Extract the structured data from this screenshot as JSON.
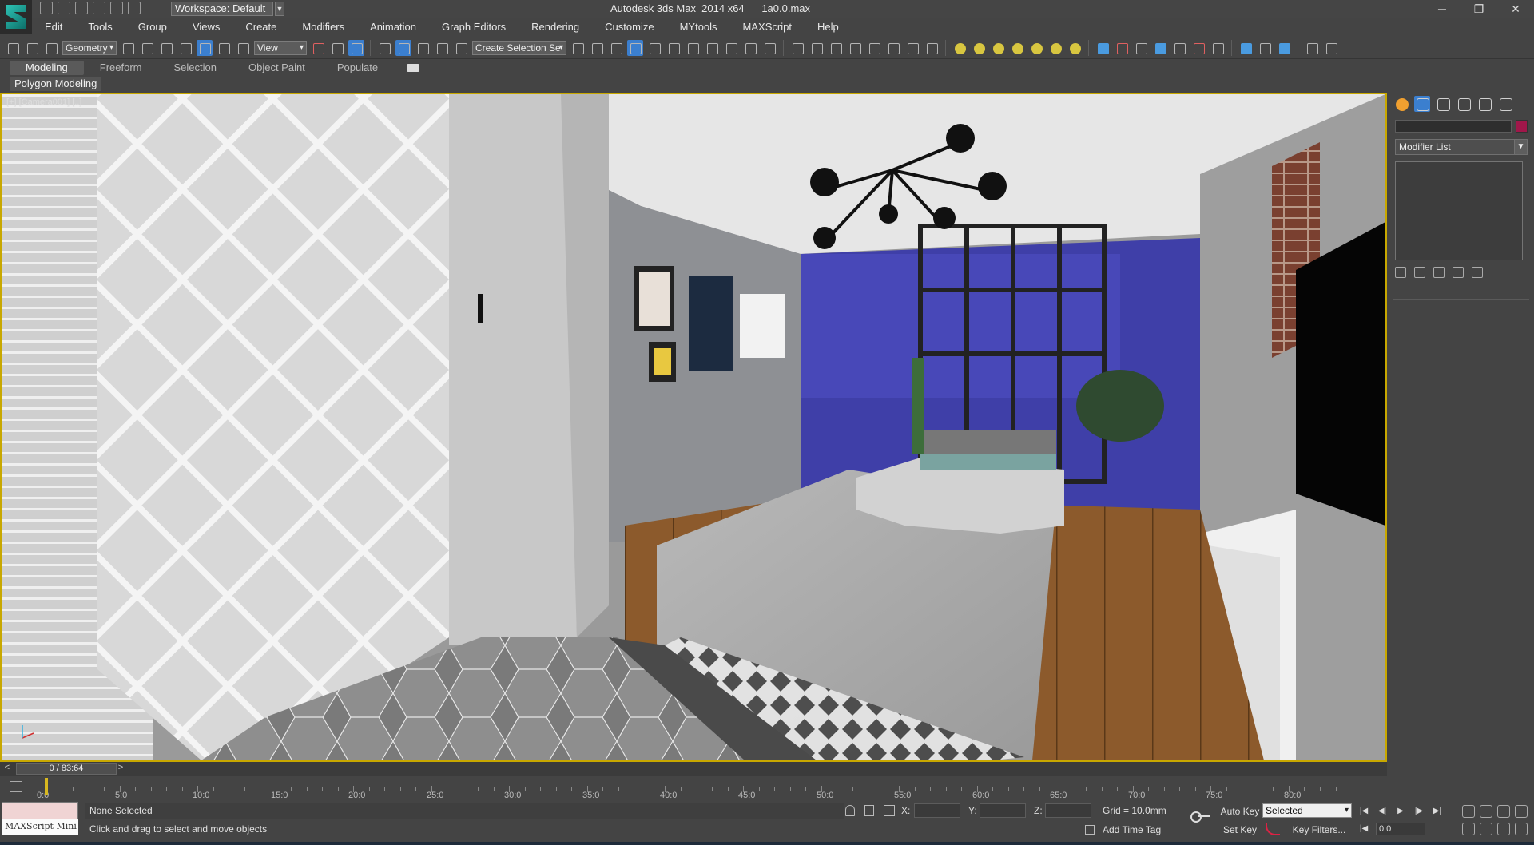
{
  "titlebar": {
    "workspace_label": "Workspace: Default",
    "window_title": "Autodesk 3ds Max  2014 x64      1a0.0.max",
    "minimize": "─",
    "restore": "❐",
    "close": "✕"
  },
  "menu": {
    "items": [
      "Edit",
      "Tools",
      "Group",
      "Views",
      "Create",
      "Modifiers",
      "Animation",
      "Graph Editors",
      "Rendering",
      "Customize",
      "MYtools",
      "MAXScript",
      "Help"
    ]
  },
  "toolbar": {
    "selection_filter": "Geometry",
    "ref_coord": "View",
    "named_selection": "Create Selection Se"
  },
  "ribbon": {
    "tabs": [
      "Modeling",
      "Freeform",
      "Selection",
      "Object Paint",
      "Populate"
    ],
    "active_tab": "Modeling",
    "panel_label": "Polygon Modeling"
  },
  "viewport": {
    "label": "[+] [Camera001] [..]"
  },
  "command_panel": {
    "modifier_list": "Modifier List",
    "object_color": "#a0174a"
  },
  "timeslider": {
    "frame_readout": "0 / 83:64",
    "prev": "<",
    "next": ">"
  },
  "trackbar": {
    "tick_labels": [
      "0:0",
      "5:0",
      "10:0",
      "15:0",
      "20:0",
      "25:0",
      "30:0",
      "35:0",
      "40:0",
      "45:0",
      "50:0",
      "55:0",
      "60:0",
      "65:0",
      "70:0",
      "75:0",
      "80:0"
    ]
  },
  "status": {
    "maxscript_mini": "MAXScript Mini",
    "selection_info": "None Selected",
    "prompt": "Click and drag to select and move objects",
    "x_label": "X:",
    "y_label": "Y:",
    "z_label": "Z:",
    "grid": "Grid = 10.0mm",
    "add_time_tag": "Add Time Tag",
    "auto_key": "Auto Key",
    "set_key": "Set Key",
    "key_mode": "Selected",
    "key_filters": "Key Filters...",
    "current_frame": "0:0"
  },
  "colors": {
    "viewport_border": "#c8a800",
    "active_tool": "#3b7fcf",
    "ui_background": "#444444"
  },
  "icons": [
    "app-logo-icon",
    "new-file-icon",
    "open-file-icon",
    "save-icon",
    "undo-icon",
    "redo-icon",
    "select-object-icon",
    "move-icon",
    "rotate-icon",
    "scale-icon",
    "snap-icon",
    "render-icon",
    "create-panel-icon",
    "modify-panel-icon",
    "hierarchy-panel-icon",
    "motion-panel-icon",
    "display-panel-icon",
    "utilities-panel-icon",
    "key-icon",
    "lock-icon",
    "play-icon"
  ]
}
